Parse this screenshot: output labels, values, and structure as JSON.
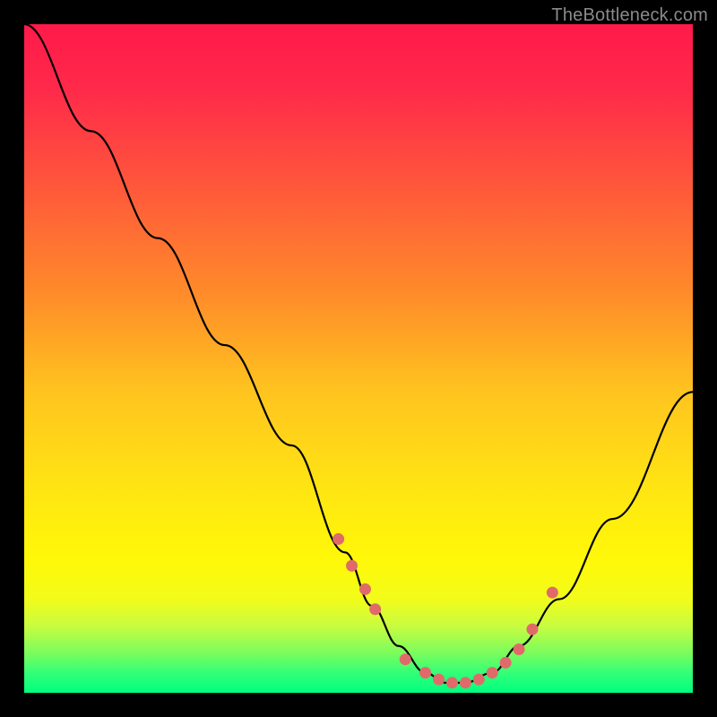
{
  "watermark": "TheBottleneck.com",
  "chart_data": {
    "type": "line",
    "title": "",
    "xlabel": "",
    "ylabel": "",
    "xlim": [
      0,
      100
    ],
    "ylim": [
      0,
      100
    ],
    "grid": false,
    "legend": false,
    "x": [
      0,
      10,
      20,
      30,
      40,
      48,
      52,
      56,
      60,
      63,
      66,
      70,
      74,
      80,
      88,
      100
    ],
    "y": [
      100,
      84,
      68,
      52,
      37,
      21,
      13,
      7,
      3,
      1.5,
      1.5,
      3,
      7,
      14,
      26,
      45
    ],
    "scatter_x": [
      47,
      49,
      51,
      52.5,
      57,
      60,
      62,
      64,
      66,
      68,
      70,
      72,
      74,
      76,
      79
    ],
    "scatter_y": [
      23,
      19,
      15.5,
      12.5,
      5,
      3,
      2,
      1.5,
      1.5,
      2,
      3,
      4.5,
      6.5,
      9.5,
      15
    ],
    "colors": {
      "curve": "#000000",
      "dots": "#e06a6a",
      "gradient_top": "#ff1a4a",
      "gradient_bottom": "#00ff7f"
    }
  }
}
